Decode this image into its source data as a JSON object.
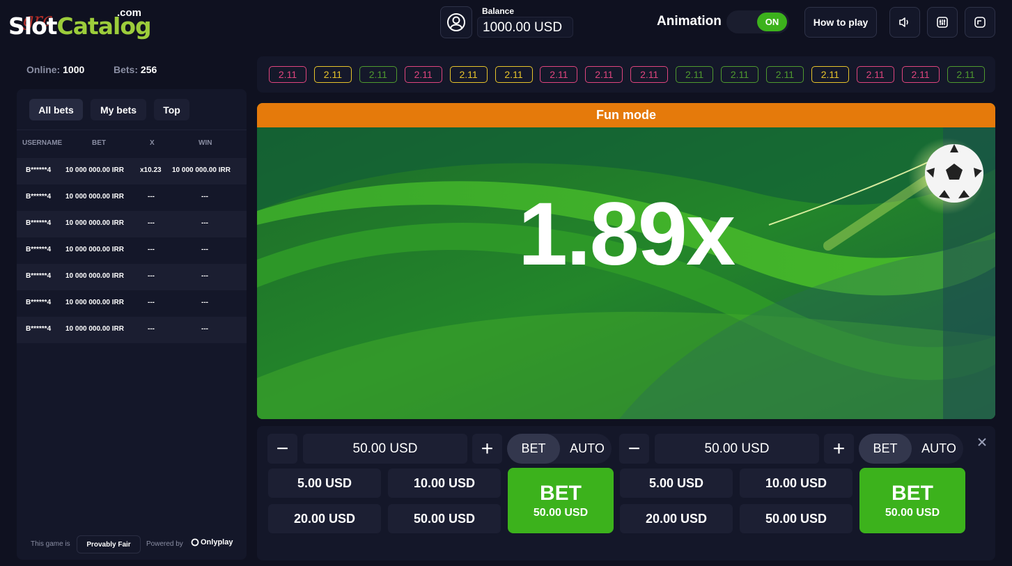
{
  "colors": {
    "accent_green": "#3cb21c",
    "fun_mode": "#e57a0b",
    "chip_pink": "#e0457e",
    "chip_yellow": "#e8c42a",
    "chip_green": "#4f9a2f"
  },
  "header": {
    "logo_main": "Slot",
    "logo_accent": "Catalog",
    "logo_suffix": ".com",
    "balance_label": "Balance",
    "balance_value": "1000.00 USD",
    "animation_label": "Animation",
    "animation_state": "ON",
    "how_to_play": "How to play",
    "icons": [
      "user-icon",
      "sound-icon",
      "settings-icon",
      "chat-icon"
    ]
  },
  "stats": {
    "online_label": "Online:",
    "online_value": "1000",
    "bets_label": "Bets:",
    "bets_value": "256"
  },
  "bets_panel": {
    "tabs": [
      "All bets",
      "My bets",
      "Top"
    ],
    "columns": [
      "USERNAME",
      "BET",
      "X",
      "WIN"
    ],
    "rows": [
      {
        "user": "B******4",
        "bet": "10 000 000.00 IRR",
        "x": "x10.23",
        "win": "10 000 000.00 IRR"
      },
      {
        "user": "B******4",
        "bet": "10 000 000.00 IRR",
        "x": "---",
        "win": "---"
      },
      {
        "user": "B******4",
        "bet": "10 000 000.00 IRR",
        "x": "---",
        "win": "---"
      },
      {
        "user": "B******4",
        "bet": "10 000 000.00 IRR",
        "x": "---",
        "win": "---"
      },
      {
        "user": "B******4",
        "bet": "10 000 000.00 IRR",
        "x": "---",
        "win": "---"
      },
      {
        "user": "B******4",
        "bet": "10 000 000.00 IRR",
        "x": "---",
        "win": "---"
      },
      {
        "user": "B******4",
        "bet": "10 000 000.00 IRR",
        "x": "---",
        "win": "---"
      }
    ],
    "footer_prefix": "This game is",
    "footer_button": "Provably Fair",
    "footer_powered": "Powered by",
    "footer_brand": "Onlyplay"
  },
  "history": [
    {
      "value": "2.11",
      "color": "pink"
    },
    {
      "value": "2.11",
      "color": "yellow"
    },
    {
      "value": "2.11",
      "color": "green"
    },
    {
      "value": "2.11",
      "color": "pink"
    },
    {
      "value": "2.11",
      "color": "yellow"
    },
    {
      "value": "2.11",
      "color": "yellow"
    },
    {
      "value": "2.11",
      "color": "pink"
    },
    {
      "value": "2.11",
      "color": "pink"
    },
    {
      "value": "2.11",
      "color": "pink"
    },
    {
      "value": "2.11",
      "color": "green"
    },
    {
      "value": "2.11",
      "color": "green"
    },
    {
      "value": "2.11",
      "color": "green"
    },
    {
      "value": "2.11",
      "color": "yellow"
    },
    {
      "value": "2.11",
      "color": "pink"
    },
    {
      "value": "2.11",
      "color": "pink"
    },
    {
      "value": "2.11",
      "color": "green"
    }
  ],
  "game": {
    "mode_banner": "Fun mode",
    "multiplier": "1.89x"
  },
  "bet_panels": [
    {
      "minus": "−",
      "plus": "+",
      "amount": "50.00 USD",
      "mode_bet": "BET",
      "mode_auto": "AUTO",
      "quick": [
        "5.00 USD",
        "10.00 USD",
        "20.00 USD",
        "50.00 USD"
      ],
      "bet_button": "BET",
      "bet_amount": "50.00 USD"
    },
    {
      "minus": "−",
      "plus": "+",
      "amount": "50.00 USD",
      "mode_bet": "BET",
      "mode_auto": "AUTO",
      "quick": [
        "5.00 USD",
        "10.00 USD",
        "20.00 USD",
        "50.00 USD"
      ],
      "bet_button": "BET",
      "bet_amount": "50.00 USD"
    }
  ]
}
